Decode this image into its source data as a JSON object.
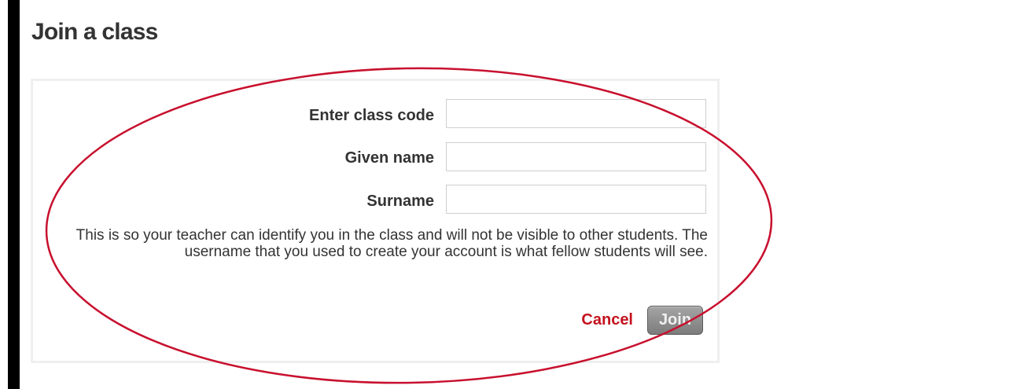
{
  "page": {
    "title": "Join a class"
  },
  "form": {
    "class_code_label": "Enter class code",
    "class_code_value": "",
    "given_name_label": "Given name",
    "given_name_value": "",
    "surname_label": "Surname",
    "surname_value": "",
    "help_text": "This is so your teacher can identify you in the class and will not be visible to other students. The username that you used to create your account is what fellow students will see.",
    "cancel_label": "Cancel",
    "join_label": "Join"
  },
  "colors": {
    "cancel": "#c4121e",
    "annotation": "#c8102e",
    "join_button": "#8c8c8c",
    "left_bar": "#000000"
  }
}
